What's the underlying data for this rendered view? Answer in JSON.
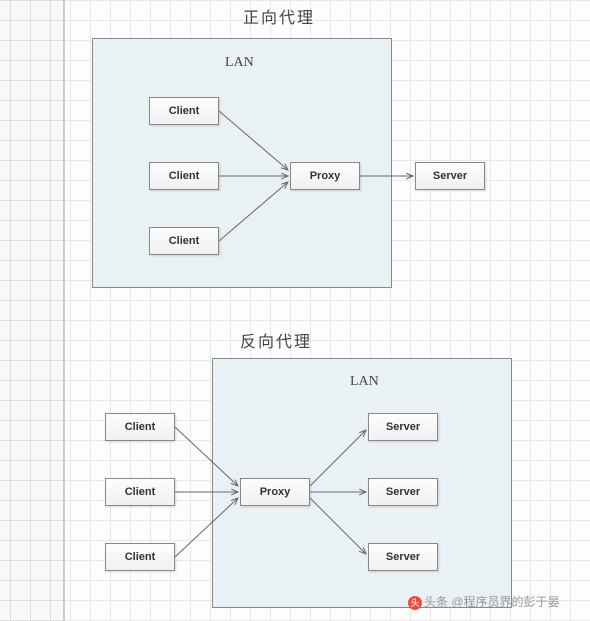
{
  "diagram1": {
    "title": "正向代理",
    "lan_label": "LAN",
    "clients": [
      "Client",
      "Client",
      "Client"
    ],
    "proxy": "Proxy",
    "server": "Server"
  },
  "diagram2": {
    "title": "反向代理",
    "lan_label": "LAN",
    "clients": [
      "Client",
      "Client",
      "Client"
    ],
    "proxy": "Proxy",
    "servers": [
      "Server",
      "Server",
      "Server"
    ]
  },
  "watermark": {
    "prefix": "头条",
    "text": "@程序员界的彭于晏"
  }
}
